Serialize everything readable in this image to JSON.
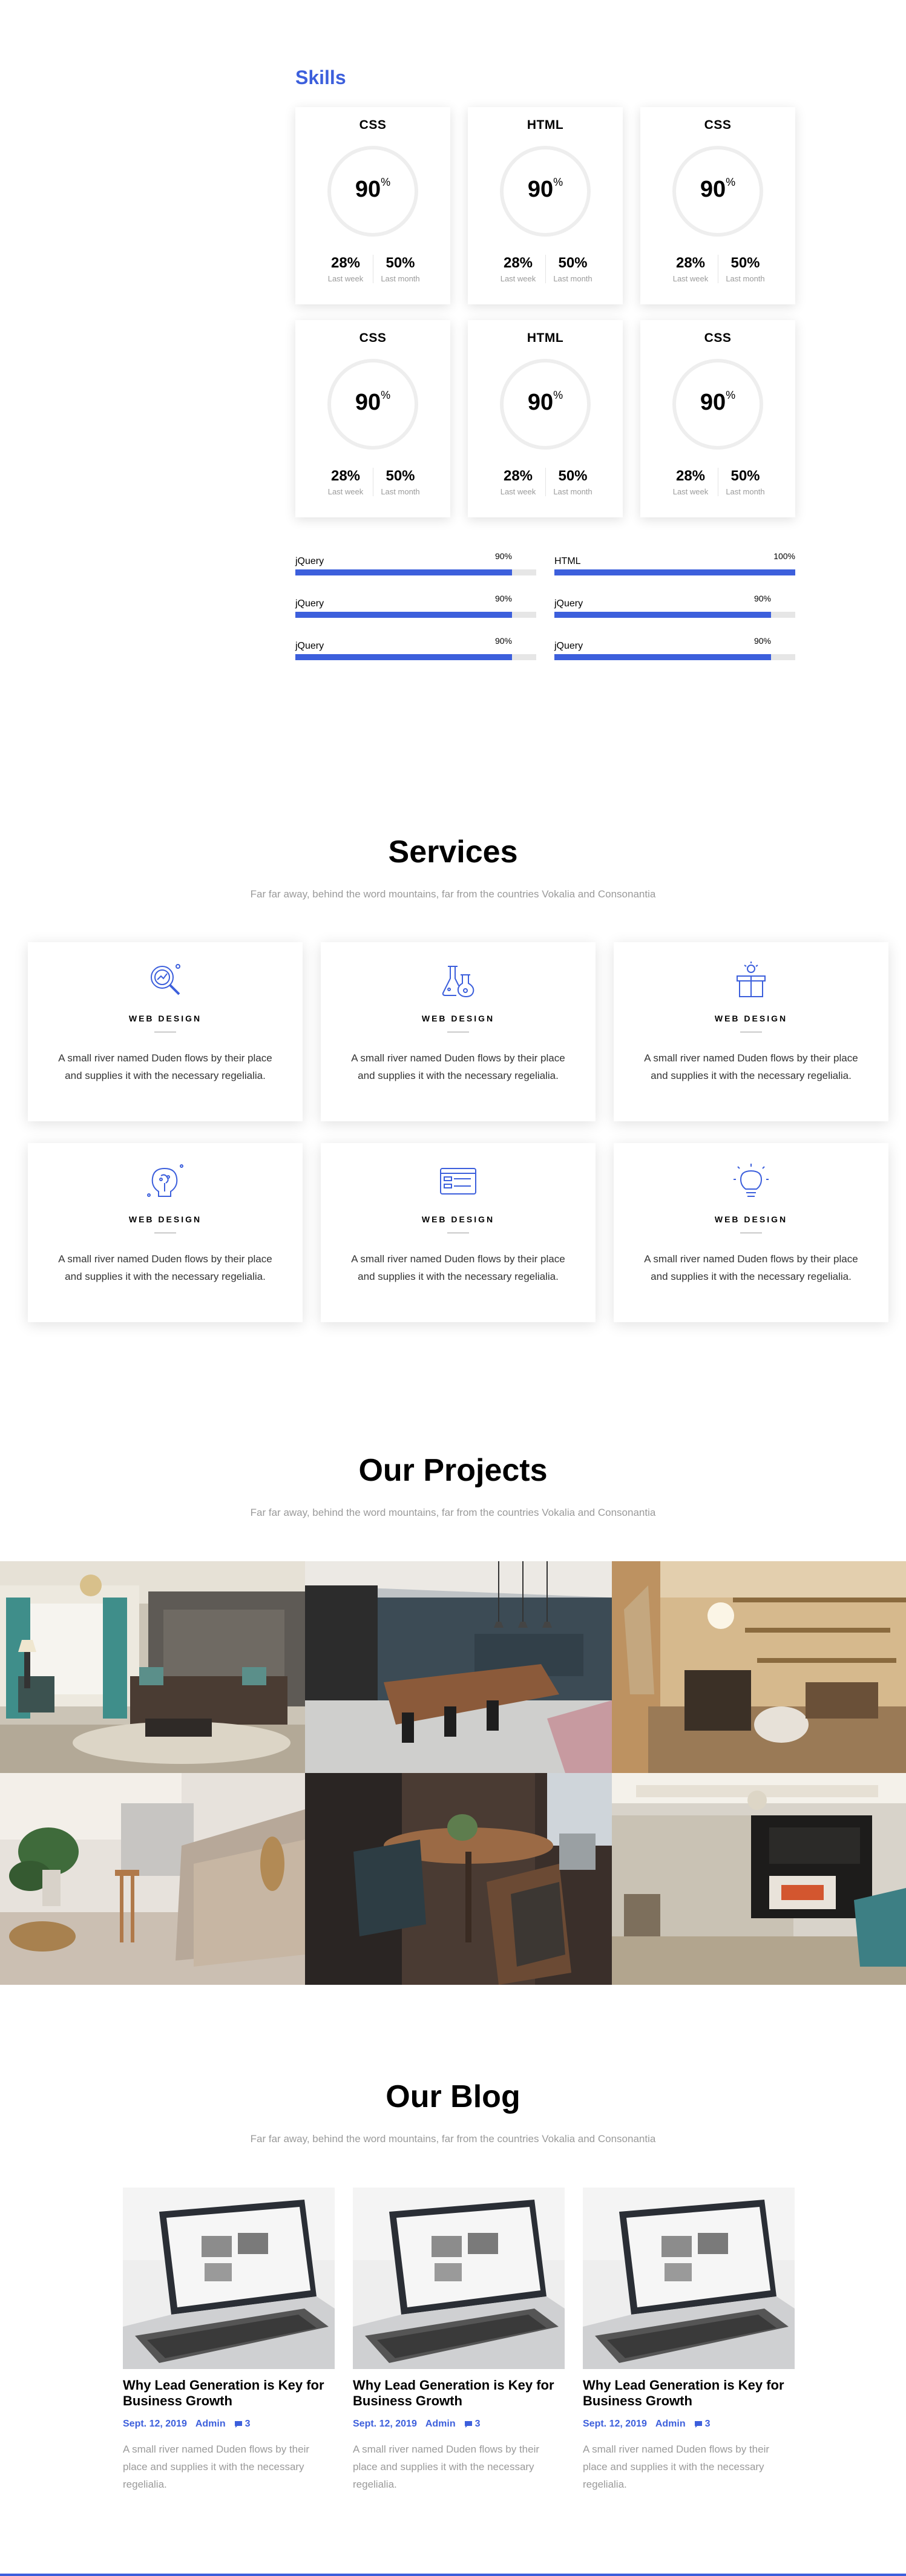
{
  "skills": {
    "title": "Skills",
    "cards": [
      {
        "name": "CSS",
        "value": "90",
        "unit": "%",
        "week_value": "28%",
        "week_label": "Last week",
        "month_value": "50%",
        "month_label": "Last month"
      },
      {
        "name": "HTML",
        "value": "90",
        "unit": "%",
        "week_value": "28%",
        "week_label": "Last week",
        "month_value": "50%",
        "month_label": "Last month"
      },
      {
        "name": "CSS",
        "value": "90",
        "unit": "%",
        "week_value": "28%",
        "week_label": "Last week",
        "month_value": "50%",
        "month_label": "Last month"
      },
      {
        "name": "CSS",
        "value": "90",
        "unit": "%",
        "week_value": "28%",
        "week_label": "Last week",
        "month_value": "50%",
        "month_label": "Last month"
      },
      {
        "name": "HTML",
        "value": "90",
        "unit": "%",
        "week_value": "28%",
        "week_label": "Last week",
        "month_value": "50%",
        "month_label": "Last month"
      },
      {
        "name": "CSS",
        "value": "90",
        "unit": "%",
        "week_value": "28%",
        "week_label": "Last week",
        "month_value": "50%",
        "month_label": "Last month"
      }
    ],
    "bars": [
      {
        "label": "jQuery",
        "percent_text": "90%",
        "level": 0.9
      },
      {
        "label": "HTML",
        "percent_text": "100%",
        "level": 1.0
      },
      {
        "label": "jQuery",
        "percent_text": "90%",
        "level": 0.9
      },
      {
        "label": "jQuery",
        "percent_text": "90%",
        "level": 0.9
      },
      {
        "label": "jQuery",
        "percent_text": "90%",
        "level": 0.9
      },
      {
        "label": "jQuery",
        "percent_text": "90%",
        "level": 0.9
      }
    ]
  },
  "services": {
    "title": "Services",
    "subtitle": "Far far away, behind the word mountains, far from the countries Vokalia and Consonantia",
    "items": [
      {
        "icon": "search-analytics-icon",
        "title": "WEB DESIGN",
        "text": "A small river named Duden flows by their place and supplies it with the necessary regelialia."
      },
      {
        "icon": "lab-flasks-icon",
        "title": "WEB DESIGN",
        "text": "A small river named Duden flows by their place and supplies it with the necessary regelialia."
      },
      {
        "icon": "gift-idea-icon",
        "title": "WEB DESIGN",
        "text": "A small river named Duden flows by their place and supplies it with the necessary regelialia."
      },
      {
        "icon": "brain-idea-icon",
        "title": "WEB DESIGN",
        "text": "A small river named Duden flows by their place and supplies it with the necessary regelialia."
      },
      {
        "icon": "browser-window-icon",
        "title": "WEB DESIGN",
        "text": "A small river named Duden flows by their place and supplies it with the necessary regelialia."
      },
      {
        "icon": "lightbulb-icon",
        "title": "WEB DESIGN",
        "text": "A small river named Duden flows by their place and supplies it with the necessary regelialia."
      }
    ]
  },
  "projects": {
    "title": "Our Projects",
    "subtitle": "Far far away, behind the word mountains, far from the countries Vokalia and Consonantia",
    "photos": [
      "living-room-teal-curtains",
      "dining-kitchen-pendant-lights",
      "reading-nook-shelves",
      "cozy-sofa-plant",
      "round-dining-table",
      "fireplace-lounge"
    ]
  },
  "blog": {
    "title": "Our Blog",
    "subtitle": "Far far away, behind the word mountains, far from the countries Vokalia and Consonantia",
    "posts": [
      {
        "title": "Why Lead Generation is Key for Business Growth",
        "date": "Sept. 12, 2019",
        "author": "Admin",
        "comments": "3",
        "excerpt": "A small river named Duden flows by their place and supplies it with the necessary regelialia."
      },
      {
        "title": "Why Lead Generation is Key for Business Growth",
        "date": "Sept. 12, 2019",
        "author": "Admin",
        "comments": "3",
        "excerpt": "A small river named Duden flows by their place and supplies it with the necessary regelialia."
      },
      {
        "title": "Why Lead Generation is Key for Business Growth",
        "date": "Sept. 12, 2019",
        "author": "Admin",
        "comments": "3",
        "excerpt": "A small river named Duden flows by their place and supplies it with the necessary regelialia."
      }
    ]
  },
  "colors": {
    "accent": "#3c5fdc",
    "muted_text": "#9a9a9a",
    "track": "#e6e6e6"
  }
}
